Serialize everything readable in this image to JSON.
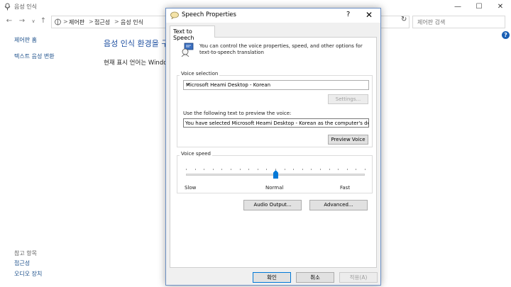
{
  "window": {
    "title": "음성 인식",
    "controls": {
      "minimize": "—",
      "maximize": "☐",
      "close": "✕"
    }
  },
  "nav": {
    "back": "←",
    "forward": "→",
    "up": "↑",
    "breadcrumbs": [
      "제어판",
      "접근성",
      "음성 인식"
    ],
    "separator": ">",
    "refresh": "↻",
    "search_placeholder": "제어판 검색"
  },
  "sidebar": {
    "links": [
      "제어판 홈",
      "텍스트 음성 변환"
    ],
    "see_also_heading": "참고 항목",
    "see_also": [
      "접근성",
      "오디오 장치"
    ]
  },
  "main": {
    "title": "음성 인식 환경을 구",
    "text": "현재 표시 언어는 Windows"
  },
  "dialog": {
    "title": "Speech Properties",
    "help": "?",
    "close": "✕",
    "tab": "Text to Speech",
    "intro_line1": "You can control the voice properties, speed, and other options for",
    "intro_line2": "text-to-speech translation",
    "voice_selection_label": "Voice selection",
    "voice_selected": "Microsoft Heami Desktop - Korean",
    "settings_button": "Settings...",
    "preview_label": "Use the following text to preview the voice:",
    "preview_text": "You have selected Microsoft Heami Desktop - Korean as the computer's default voice.",
    "preview_button": "Preview Voice",
    "voice_speed_label": "Voice speed",
    "speed_slow": "Slow",
    "speed_normal": "Normal",
    "speed_fast": "Fast",
    "speed_value_fraction": 0.5,
    "audio_output_button": "Audio Output...",
    "advanced_button": "Advanced...",
    "ok_button": "확인",
    "cancel_button": "취소",
    "apply_button": "적용(A)"
  },
  "colors": {
    "accent": "#0078d7",
    "link": "#1a4e8a",
    "heading": "#1e4fa0"
  }
}
